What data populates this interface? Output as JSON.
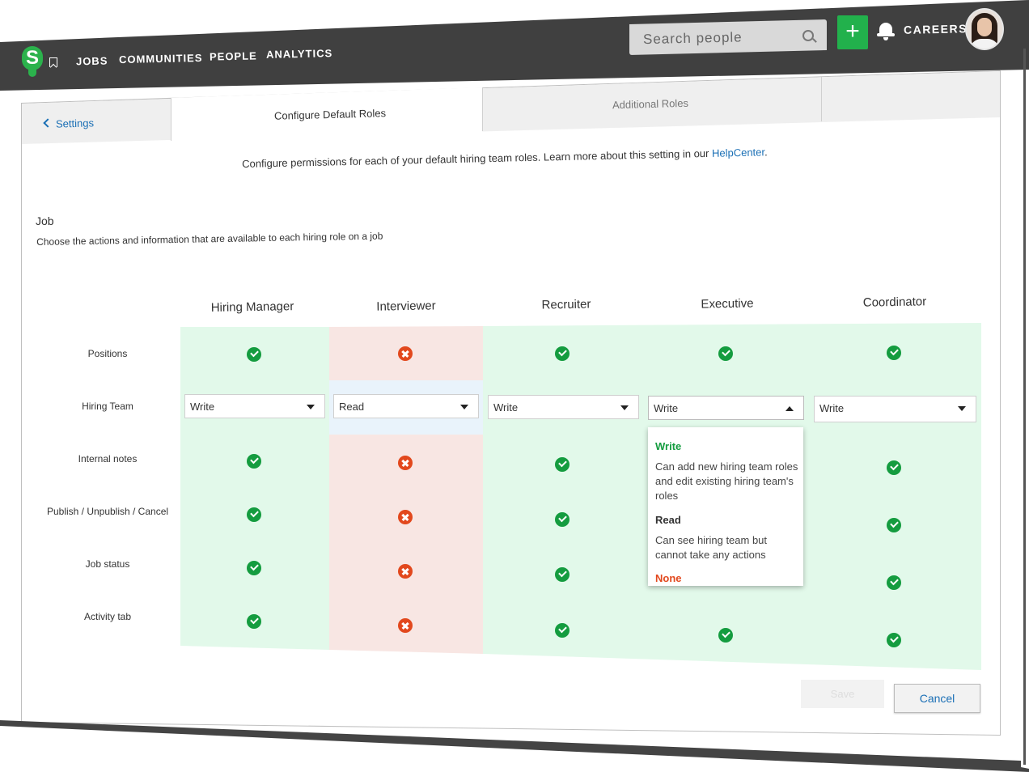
{
  "brand": {
    "logo_letter": "S",
    "color": "#2bb24c"
  },
  "nav": {
    "items": [
      {
        "label": "JOBS"
      },
      {
        "label": "COMMUNITIES"
      },
      {
        "label": "PEOPLE"
      },
      {
        "label": "ANALYTICS"
      }
    ],
    "search_placeholder": "Search people",
    "add_label": "+",
    "careers_label": "CAREERS"
  },
  "tabs": {
    "back_label": "Settings",
    "active_label": "Configure Default Roles",
    "other_label": "Additional Roles"
  },
  "intro": {
    "text": "Configure permissions for each of your default hiring team roles. Learn more about this setting in our ",
    "link": "HelpCenter",
    "suffix": "."
  },
  "section": {
    "title": "Job",
    "description": "Choose the actions and information that are available to each hiring role on a job"
  },
  "matrix": {
    "roles": [
      "Hiring Manager",
      "Interviewer",
      "Recruiter",
      "Executive",
      "Coordinator"
    ],
    "rows": [
      "Positions",
      "Hiring Team",
      "Internal notes",
      "Publish / Unpublish / Cancel",
      "Job status",
      "Activity tab"
    ],
    "hiring_team_values": [
      "Write",
      "Read",
      "Write",
      "Write",
      "Write"
    ],
    "permissions": {
      "Positions": [
        "yes",
        "no",
        "yes",
        "yes",
        "yes"
      ],
      "Internal notes": [
        "yes",
        "no",
        "yes",
        "hidden",
        "yes"
      ],
      "Publish / Unpublish / Cancel": [
        "yes",
        "no",
        "yes",
        "hidden",
        "yes"
      ],
      "Job status": [
        "yes",
        "no",
        "yes",
        "hidden",
        "yes"
      ],
      "Activity tab": [
        "yes",
        "no",
        "yes",
        "yes",
        "yes"
      ]
    },
    "colors": {
      "allowed": "#e2f9ea",
      "denied": "#f8e6e3",
      "check": "#149c3f",
      "cross": "#e2481d"
    }
  },
  "dropdown": {
    "options": [
      {
        "title": "Write",
        "desc": "Can add new hiring team roles and edit existing hiring team's roles",
        "color": "#149c3f"
      },
      {
        "title": "Read",
        "desc": "Can see hiring team but cannot take any actions",
        "color": "#333333"
      },
      {
        "title": "None",
        "desc": "",
        "color": "#e2481d"
      }
    ]
  },
  "actions": {
    "save_label": "Save",
    "cancel_label": "Cancel"
  }
}
